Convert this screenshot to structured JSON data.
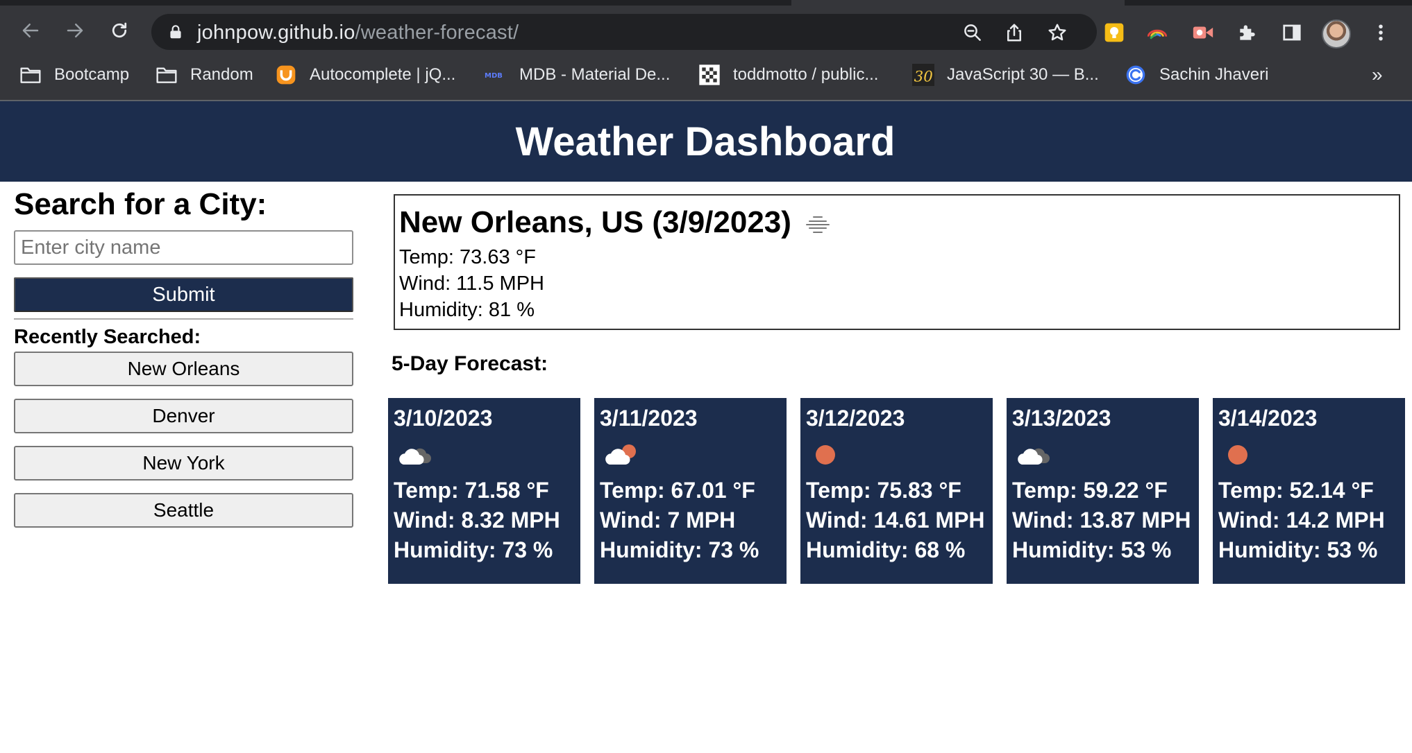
{
  "browser": {
    "url_host": "johnpow.github.io",
    "url_path": "/weather-forecast/",
    "bookmarks": [
      {
        "label": "Bootcamp",
        "icon": "folder-icon"
      },
      {
        "label": "Random",
        "icon": "folder-icon"
      },
      {
        "label": "Autocomplete | jQ...",
        "icon": "jquery-ui-icon"
      },
      {
        "label": "MDB - Material De...",
        "icon": "mdb-icon"
      },
      {
        "label": "toddmotto / public...",
        "icon": "github-avatar-icon"
      },
      {
        "label": "JavaScript 30 — B...",
        "icon": "js30-icon"
      },
      {
        "label": "Sachin Jhaveri",
        "icon": "c-logo-icon"
      }
    ],
    "overflow_label": "»"
  },
  "header": {
    "title": "Weather Dashboard"
  },
  "search": {
    "heading": "Search for a City:",
    "placeholder": "Enter city name",
    "submit_label": "Submit",
    "recent_label": "Recently Searched:",
    "history": [
      "New Orleans",
      "Denver",
      "New York",
      "Seattle"
    ]
  },
  "current": {
    "title": "New Orleans, US (3/9/2023)",
    "icon": "mist-icon",
    "temp": "Temp: 73.63 °F",
    "wind": "Wind: 11.5 MPH",
    "humidity": "Humidity: 81 %"
  },
  "forecast": {
    "label": "5-Day Forecast:",
    "days": [
      {
        "date": "3/10/2023",
        "icon": "broken-clouds-icon",
        "temp": "Temp: 71.58 °F",
        "wind": "Wind: 8.32 MPH",
        "humidity": "Humidity: 73 %"
      },
      {
        "date": "3/11/2023",
        "icon": "few-clouds-icon",
        "temp": "Temp: 67.01 °F",
        "wind": "Wind: 7 MPH",
        "humidity": "Humidity: 73 %"
      },
      {
        "date": "3/12/2023",
        "icon": "clear-sky-icon",
        "temp": "Temp: 75.83 °F",
        "wind": "Wind: 14.61 MPH",
        "humidity": "Humidity: 68 %"
      },
      {
        "date": "3/13/2023",
        "icon": "broken-clouds-icon",
        "temp": "Temp: 59.22 °F",
        "wind": "Wind: 13.87 MPH",
        "humidity": "Humidity: 53 %"
      },
      {
        "date": "3/14/2023",
        "icon": "clear-sky-icon",
        "temp": "Temp: 52.14 °F",
        "wind": "Wind: 14.2 MPH",
        "humidity": "Humidity: 53 %"
      }
    ]
  },
  "colors": {
    "navy": "#1c2d4d",
    "sun": "#e0704f",
    "chrome_bg": "#35363a",
    "omnibox_bg": "#202124"
  }
}
